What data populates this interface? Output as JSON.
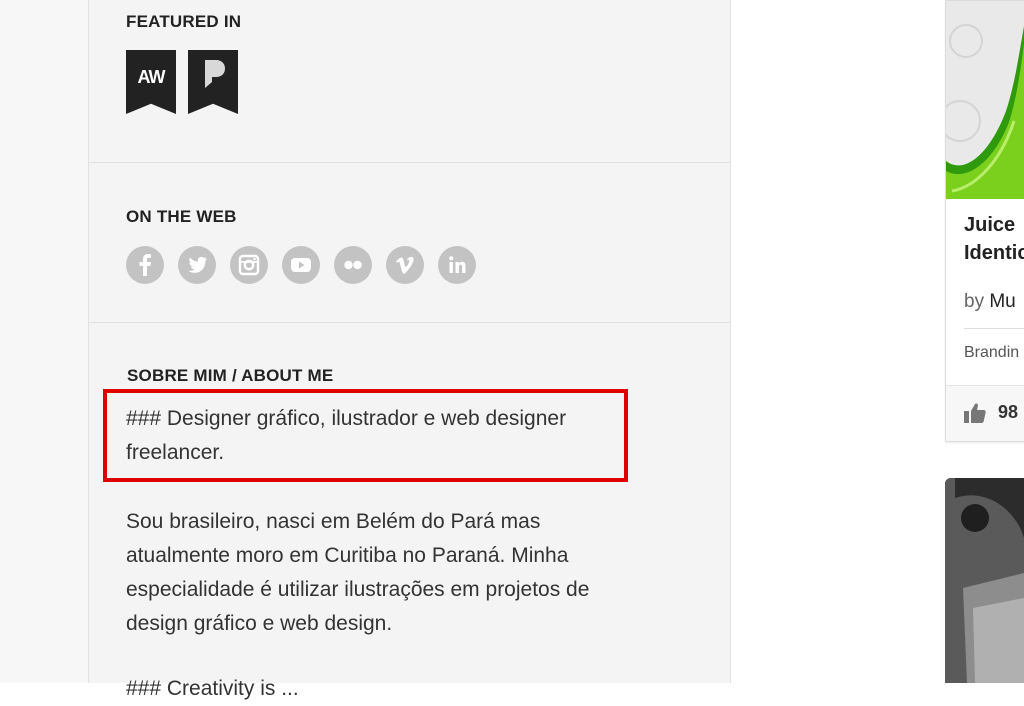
{
  "sidebar": {
    "featured_heading": "FEATURED IN",
    "badges": [
      {
        "label": "AW",
        "name": "awwwards-badge"
      },
      {
        "label": "",
        "name": "the-p-badge"
      }
    ],
    "web_heading": "ON THE WEB",
    "social": [
      {
        "name": "facebook-icon",
        "glyph": "f"
      },
      {
        "name": "twitter-icon",
        "glyph": "t"
      },
      {
        "name": "instagram-icon",
        "glyph": "i"
      },
      {
        "name": "youtube-icon",
        "glyph": "y"
      },
      {
        "name": "flickr-icon",
        "glyph": "fl"
      },
      {
        "name": "vimeo-icon",
        "glyph": "v"
      },
      {
        "name": "linkedin-icon",
        "glyph": "in"
      }
    ],
    "about_heading": "SOBRE MIM / ABOUT ME",
    "about_highlight_line1": "### Designer gráfico, ilustrador e web designer",
    "about_highlight_line2": "freelancer.",
    "about_para_lines": [
      "Sou brasileiro, nasci em Belém do Pará mas",
      "atualmente moro em Curitiba no Paraná. Minha",
      "especialidade é utilizar ilustrações em projetos de",
      "design gráfico e web design."
    ],
    "about_next_line": "### Creativity is ..."
  },
  "project_card": {
    "title_line1": "Juice",
    "title_line2": "Identic",
    "by_prefix": "by",
    "by_name": "Mu",
    "field": "Brandin",
    "likes": "98"
  },
  "colors": {
    "highlight": "#e00000",
    "icon_gray": "#c3c3c3",
    "accent_green": "#7bd01e"
  }
}
